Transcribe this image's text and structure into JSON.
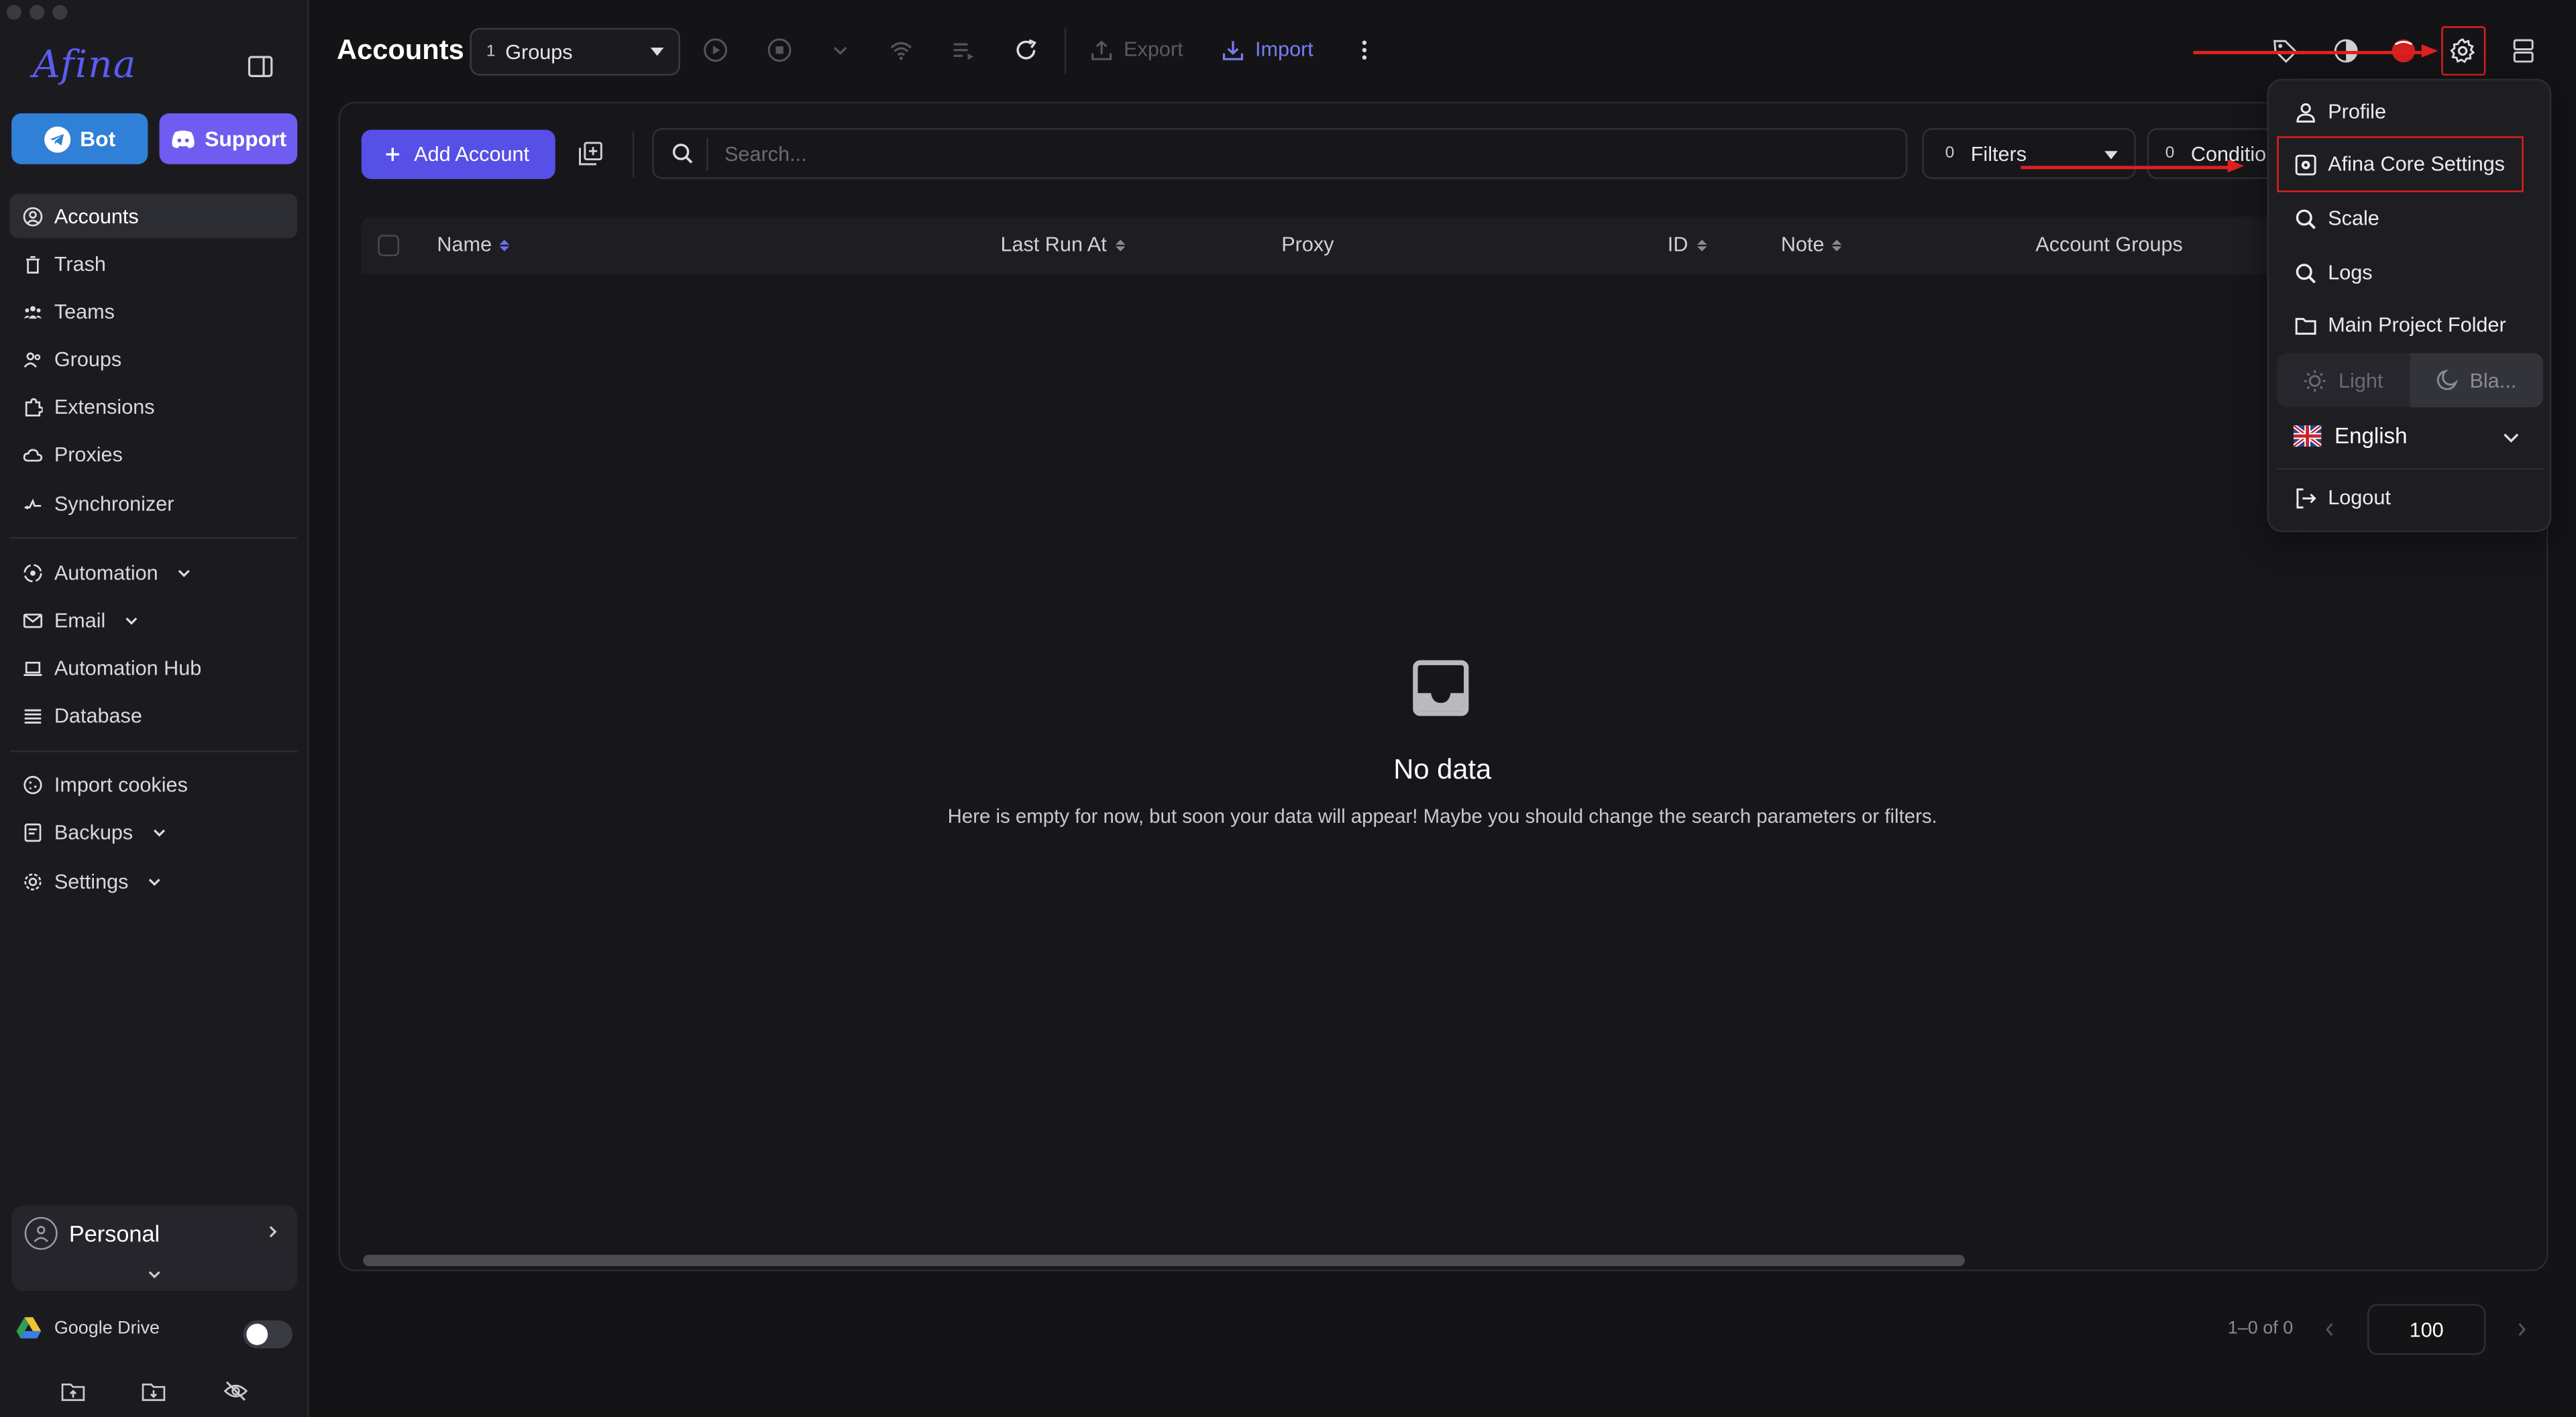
{
  "app": {
    "logo_text": "Afina"
  },
  "sidebar": {
    "bot_label": "Bot",
    "support_label": "Support",
    "items_primary": [
      {
        "label": "Accounts",
        "icon": "user-circle-icon"
      },
      {
        "label": "Trash",
        "icon": "trash-icon"
      },
      {
        "label": "Teams",
        "icon": "team-icon"
      },
      {
        "label": "Groups",
        "icon": "group-icon"
      },
      {
        "label": "Extensions",
        "icon": "puzzle-icon"
      },
      {
        "label": "Proxies",
        "icon": "cloud-icon"
      },
      {
        "label": "Synchronizer",
        "icon": "sync-icon"
      }
    ],
    "items_secondary": [
      {
        "label": "Automation",
        "icon": "automation-icon",
        "expandable": true
      },
      {
        "label": "Email",
        "icon": "mail-icon",
        "expandable": true
      },
      {
        "label": "Automation Hub",
        "icon": "laptop-icon"
      },
      {
        "label": "Database",
        "icon": "database-icon"
      }
    ],
    "items_tertiary": [
      {
        "label": "Import cookies",
        "icon": "cookie-icon"
      },
      {
        "label": "Backups",
        "icon": "backup-icon",
        "expandable": true
      },
      {
        "label": "Settings",
        "icon": "gear-icon",
        "expandable": true
      }
    ],
    "workspace": "Personal",
    "gdrive_label": "Google Drive",
    "gdrive_enabled": false
  },
  "toolbar": {
    "title": "Accounts",
    "groups_count": "1",
    "groups_label": "Groups",
    "export_label": "Export",
    "import_label": "Import"
  },
  "main": {
    "add_account_label": "Add Account",
    "search_placeholder": "Search...",
    "filters_count": "0",
    "filters_label": "Filters",
    "conditions_count": "0",
    "conditions_label": "Conditions",
    "columns": [
      "Name",
      "Last Run At",
      "Proxy",
      "ID",
      "Note",
      "Account Groups"
    ],
    "empty_title": "No data",
    "empty_subtitle": "Here is empty for now, but soon your data will appear! Maybe you should change the search parameters or filters."
  },
  "pagination": {
    "range_text": "1–0 of 0",
    "page_size": "100"
  },
  "settings_menu": {
    "items": [
      {
        "label": "Profile",
        "icon": "user-icon"
      },
      {
        "label": "Afina Core Settings",
        "icon": "core-settings-icon"
      },
      {
        "label": "Scale",
        "icon": "zoom-icon"
      },
      {
        "label": "Logs",
        "icon": "search-icon"
      },
      {
        "label": "Main Project Folder",
        "icon": "folder-icon"
      }
    ],
    "theme_light": "Light",
    "theme_dark": "Bla...",
    "language": "English",
    "logout": "Logout"
  },
  "colors": {
    "accent": "#5650e6",
    "bot": "#2f80d6",
    "support": "#6f5cf0",
    "annotation": "#e02020"
  }
}
